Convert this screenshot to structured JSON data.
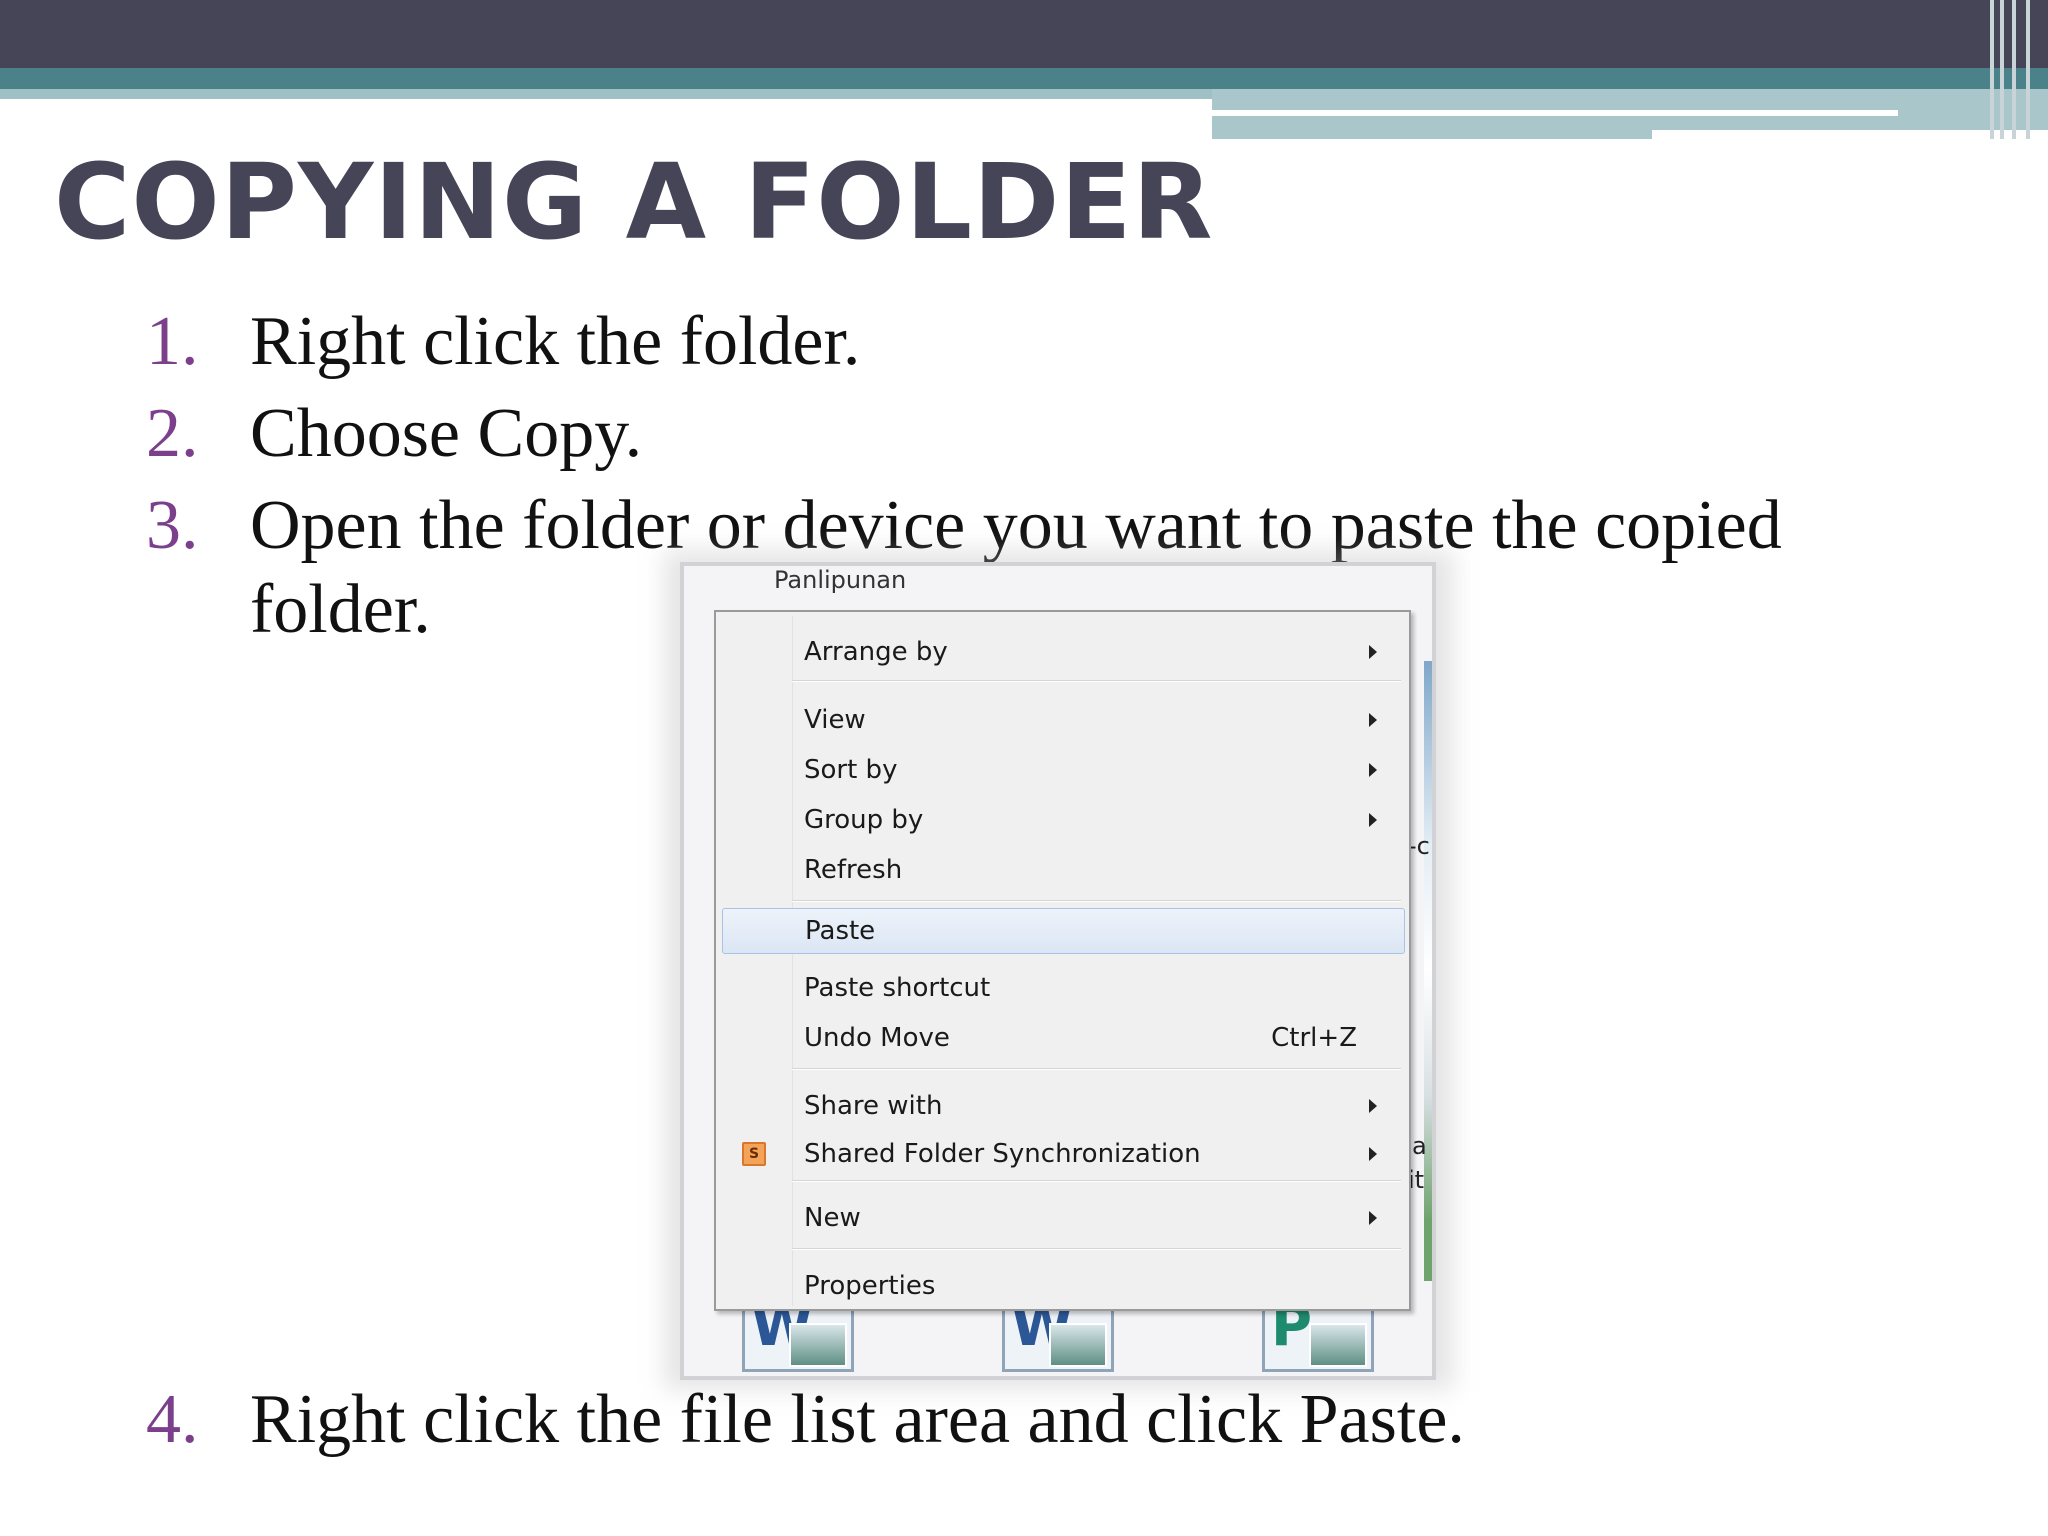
{
  "title": "COPYING A FOLDER",
  "steps": [
    {
      "num": "1.",
      "text": "Right click the folder."
    },
    {
      "num": "2.",
      "text": "Choose Copy."
    },
    {
      "num": "3.",
      "line1": "Open the folder or device you want to paste the copied",
      "line2": "folder."
    },
    {
      "num": "4.",
      "text": "Right click the file list area and click Paste."
    }
  ],
  "screenshot": {
    "breadcrumb": "Panlipunan",
    "menu": {
      "items": [
        {
          "label": "Arrange by",
          "submenu": true
        },
        {
          "label": "View",
          "submenu": true
        },
        {
          "label": "Sort by",
          "submenu": true
        },
        {
          "label": "Group by",
          "submenu": true
        },
        {
          "label": "Refresh"
        },
        {
          "label": "Paste",
          "highlighted": true
        },
        {
          "label": "Paste shortcut"
        },
        {
          "label": "Undo Move",
          "shortcut": "Ctrl+Z"
        },
        {
          "label": "Share with",
          "submenu": true
        },
        {
          "label": "Shared Folder Synchronization",
          "submenu": true,
          "icon": "sync-folder-icon",
          "icon_text": "S"
        },
        {
          "label": "New",
          "submenu": true
        },
        {
          "label": "Properties"
        }
      ]
    },
    "files": [
      {
        "icon": "word-document-icon",
        "letter": "W",
        "color": "#2b5797"
      },
      {
        "icon": "word-document-icon",
        "letter": "W",
        "color": "#2b5797"
      },
      {
        "icon": "publisher-document-icon",
        "letter": "P",
        "color": "#1e8a6e"
      }
    ]
  },
  "colors": {
    "title": "#464558",
    "step_number": "#7b3f8c",
    "header_dark": "#464558",
    "header_teal": "#4b8189"
  }
}
